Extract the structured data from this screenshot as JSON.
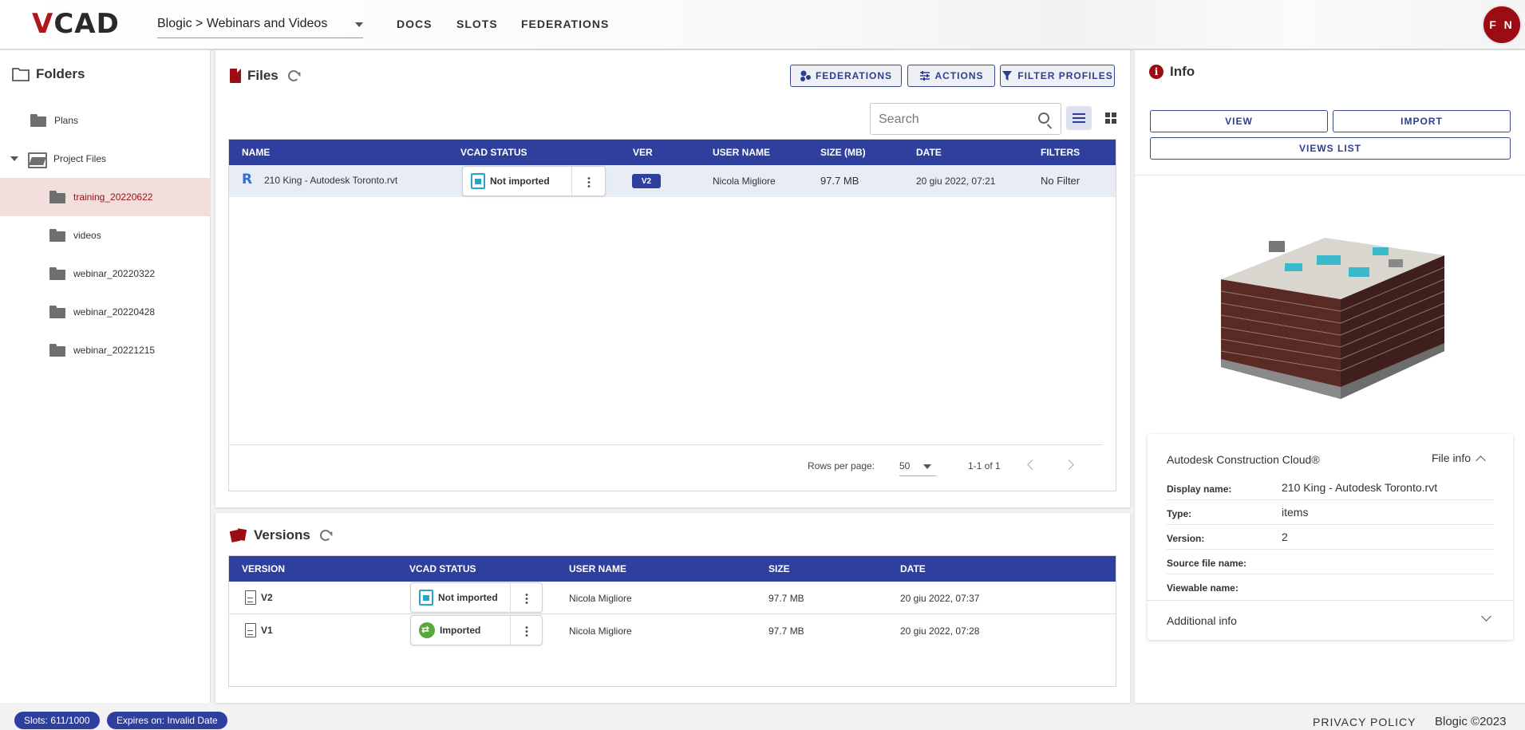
{
  "app": {
    "logo_v": "V",
    "logo_rest": "CAD",
    "breadcrumb": "Blogic > Webinars and Videos",
    "nav": [
      "DOCS",
      "SLOTS",
      "FEDERATIONS"
    ],
    "avatar_initials": "F N",
    "accent_color": "#2f3f9e",
    "brand_color": "#9b0d12"
  },
  "sidebar": {
    "title": "Folders",
    "items": [
      {
        "label": "Plans"
      },
      {
        "label": "Project Files"
      },
      {
        "label": "training_20220622"
      },
      {
        "label": "videos"
      },
      {
        "label": "webinar_20220322"
      },
      {
        "label": "webinar_20220428"
      },
      {
        "label": "webinar_20221215"
      }
    ]
  },
  "files": {
    "title": "Files",
    "buttons": {
      "federations": "FEDERATIONS",
      "actions": "ACTIONS",
      "filter_profiles": "FILTER PROFILES"
    },
    "search_placeholder": "Search",
    "columns": [
      "NAME",
      "VCAD STATUS",
      "VER",
      "USER NAME",
      "SIZE (MB)",
      "DATE",
      "FILTERS"
    ],
    "rows": [
      {
        "name": "210 King - Autodesk Toronto.rvt",
        "status": "Not imported",
        "ver": "V2",
        "user": "Nicola Migliore",
        "size": "97.7 MB",
        "date": "20 giu 2022, 07:21",
        "filters": "No Filter"
      }
    ],
    "pagination": {
      "rows_per_page_label": "Rows per page:",
      "rows_per_page": "50",
      "range": "1-1 of 1"
    }
  },
  "versions": {
    "title": "Versions",
    "columns": [
      "VERSION",
      "VCAD STATUS",
      "USER NAME",
      "SIZE",
      "DATE"
    ],
    "rows": [
      {
        "version": "V2",
        "status": "Not imported",
        "user": "Nicola Migliore",
        "size": "97.7 MB",
        "date": "20 giu 2022, 07:37"
      },
      {
        "version": "V1",
        "status": "Imported",
        "user": "Nicola Migliore",
        "size": "97.7 MB",
        "date": "20 giu 2022, 07:28"
      }
    ]
  },
  "info": {
    "title": "Info",
    "buttons": {
      "view": "VIEW",
      "import": "IMPORT",
      "views_list": "VIEWS LIST"
    },
    "source": "Autodesk Construction Cloud®",
    "file_info_label": "File info",
    "fields": [
      {
        "key": "Display name:",
        "value": "210 King - Autodesk Toronto.rvt"
      },
      {
        "key": "Type:",
        "value": "items"
      },
      {
        "key": "Version:",
        "value": "2"
      },
      {
        "key": "Source file name:",
        "value": ""
      },
      {
        "key": "Viewable name:",
        "value": ""
      }
    ],
    "additional_info": "Additional info"
  },
  "footer": {
    "slots": "Slots: 611/1000",
    "expires": "Expires on: Invalid Date",
    "privacy": "PRIVACY POLICY",
    "copyright": "Blogic ©2023"
  }
}
